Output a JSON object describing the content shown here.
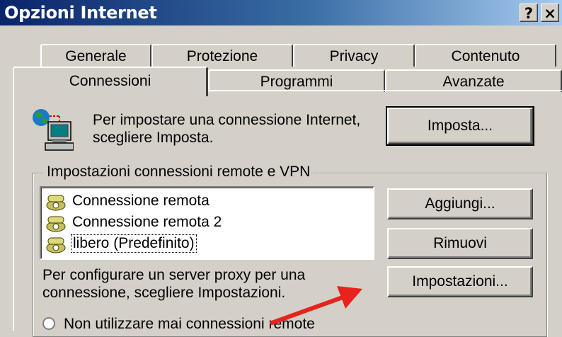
{
  "window": {
    "title": "Opzioni Internet",
    "help_label": "?",
    "close_label": "×"
  },
  "tabs_row1": [
    {
      "label": "Generale"
    },
    {
      "label": "Protezione"
    },
    {
      "label": "Privacy"
    },
    {
      "label": "Contenuto"
    }
  ],
  "tabs_row2": [
    {
      "label": "Connessioni",
      "selected": true
    },
    {
      "label": "Programmi"
    },
    {
      "label": "Avanzate"
    }
  ],
  "setup": {
    "text_line1": "Per impostare una connessione Internet,",
    "text_line2": "scegliere Imposta.",
    "button_label": "Imposta...",
    "icon": "computer-globe-icon"
  },
  "dialup_group": {
    "label": "Impostazioni connessioni remote e VPN",
    "connections": [
      {
        "name": "Connessione remota",
        "icon": "dialup-phone-icon"
      },
      {
        "name": "Connessione remota 2",
        "icon": "dialup-phone-icon"
      },
      {
        "name": "libero (Predefinito)",
        "icon": "dialup-phone-icon",
        "selected": true
      }
    ],
    "add_label": "Aggiungi...",
    "remove_label": "Rimuovi",
    "proxy_text_line1": "Per configurare un server proxy per una",
    "proxy_text_line2": "connessione, scegliere Impostazioni.",
    "settings_label": "Impostazioni...",
    "radio_partial": "Non utilizzare mai connessioni remote"
  },
  "colors": {
    "title_gradient_start": "#0a246a",
    "face": "#d4d0c8",
    "annotation_arrow": "#e8221c"
  }
}
